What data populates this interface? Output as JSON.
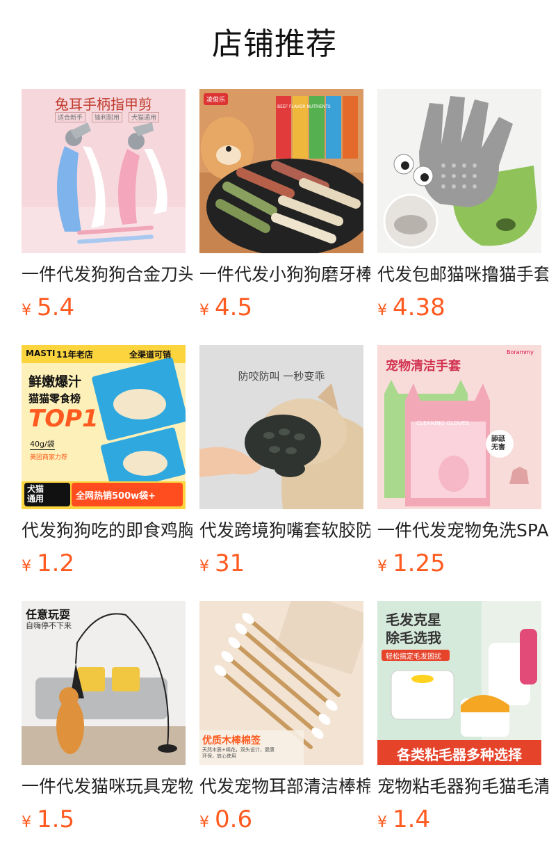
{
  "header": {
    "title": "店铺推荐"
  },
  "products": [
    {
      "name": "一件代发狗狗合金刀头指甲剪",
      "currency": "¥",
      "price": "5.4",
      "image_text": {
        "headline": "兔耳手柄指甲剪",
        "tag1": "适合新手",
        "tag2": "锋利耐用",
        "tag3": "犬猫通用"
      }
    },
    {
      "name": "一件代发小狗狗磨牙棒",
      "currency": "¥",
      "price": "4.5",
      "image_text": {
        "brand": "凌俊乐",
        "pack": "BEEF FLAVOR NUTRIENTS"
      }
    },
    {
      "name": "代发包邮猫咪撸猫手套",
      "currency": "¥",
      "price": "4.38",
      "image_text": {}
    },
    {
      "name": "代发狗狗吃的即食鸡胸肉",
      "currency": "¥",
      "price": "1.2",
      "image_text": {
        "brand": "MASTI",
        "store": "11年老店",
        "channel": "全渠道可销",
        "line1": "鲜嫩爆汁",
        "line2": "猫猫零食榜",
        "top": "TOP1",
        "weight": "40g/袋",
        "rec": "美团商家力荐",
        "pet": "犬猫\n通用",
        "hot": "全网热销500w袋+"
      }
    },
    {
      "name": "代发跨境狗嘴套软胶防咬",
      "currency": "¥",
      "price": "31",
      "image_text": {
        "headline": "防咬防叫 一秒变乖"
      }
    },
    {
      "name": "一件代发宠物免洗SPA手套",
      "currency": "¥",
      "price": "1.25",
      "image_text": {
        "brand": "Borammy",
        "headline": "宠物清洁手套",
        "pack": "CLEANING GLOVES",
        "badge": "舔舐\n无害"
      }
    },
    {
      "name": "一件代发猫咪玩具宠物逗猫棒",
      "currency": "¥",
      "price": "1.5",
      "image_text": {
        "headline": "任意玩耍",
        "sub": "自嗨停不下来"
      }
    },
    {
      "name": "代发宠物耳部清洁棒棉签",
      "currency": "¥",
      "price": "0.6",
      "image_text": {
        "headline": "优质木棒棉签",
        "sub": "天然木质+棉花，双头设计，健康环保，放心使用"
      }
    },
    {
      "name": "宠物粘毛器狗毛猫毛清理器",
      "currency": "¥",
      "price": "1.4",
      "image_text": {
        "headline": "毛发克星\n除毛选我",
        "tag": "轻松搞定毛发困扰",
        "banner": "各类粘毛器多种选择"
      }
    }
  ]
}
